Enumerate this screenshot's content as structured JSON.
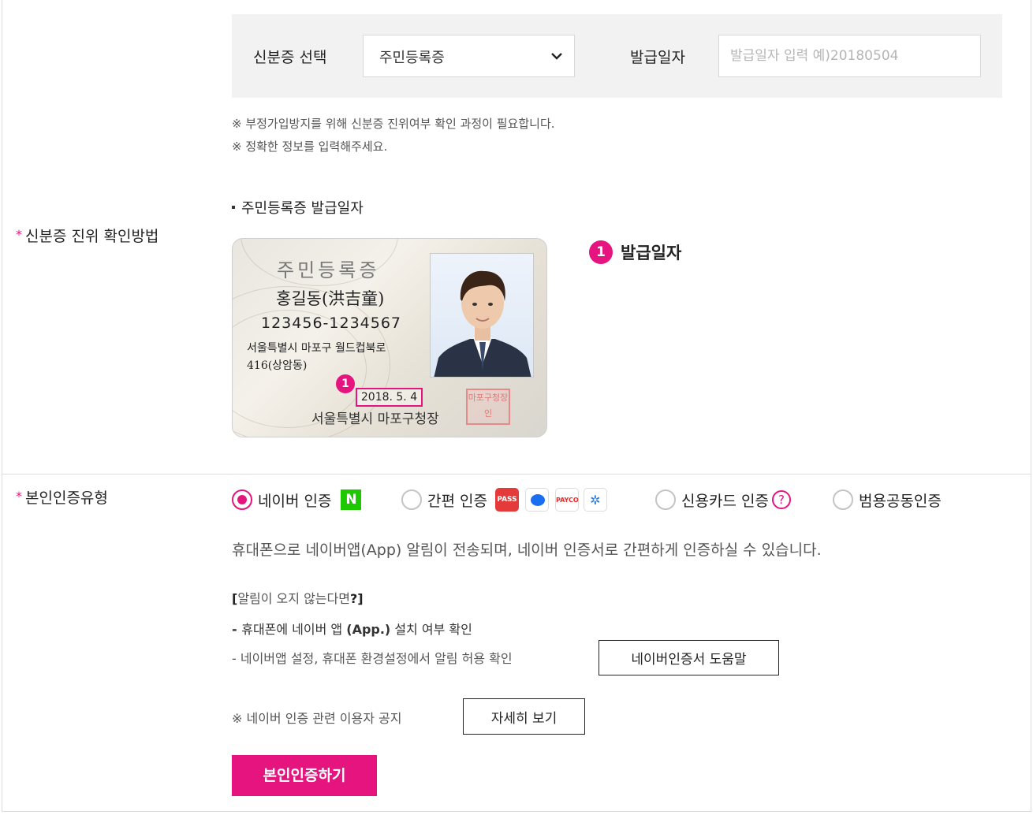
{
  "id_section": {
    "label": "신분증 진위 확인방법",
    "required_mark": "*",
    "id_type_label": "신분증 선택",
    "id_type_value": "주민등록증",
    "issue_date_label": "발급일자",
    "issue_date_placeholder": "발급일자 입력 예)20180504",
    "notices": [
      "※ 부정가입방지를 위해 신분증 진위여부 확인 과정이 필요합니다.",
      "※ 정확한 정보를 입력해주세요."
    ],
    "guide_title": "주민등록증 발급일자",
    "card": {
      "title": "주민등록증",
      "name": "홍길동(洪吉童)",
      "rrn": "123456-1234567",
      "address_line1": "서울특별시 마포구 월드컵북로",
      "address_line2": "416(상암동)",
      "issue_date": "2018. 5. 4",
      "issuer": "서울특별시 마포구청장",
      "stamp": "마포구청장인",
      "marker": "1"
    },
    "legend_number": "1",
    "legend_text": "발급일자"
  },
  "auth_section": {
    "label": "본인인증유형",
    "required_mark": "*",
    "options": [
      {
        "label": "네이버 인증",
        "selected": true
      },
      {
        "label": "간편 인증",
        "selected": false
      },
      {
        "label": "신용카드 인증",
        "selected": false
      },
      {
        "label": "범용공동인증",
        "selected": false
      }
    ],
    "logos": {
      "naver": "N",
      "pass": "PASS",
      "payco": "PAYCO",
      "kb": "✲"
    },
    "help_icon": "?",
    "description": "휴대폰으로 네이버앱(App) 알림이 전송되며, 네이버 인증서로 간편하게 인증하실 수 있습니다.",
    "tip_title_open": "[",
    "tip_title_text": "알림이 오지 않는다면",
    "tip_title_close": "?]",
    "tip1_dash": "- ",
    "tip1_a": "휴대폰에 네이버 앱 ",
    "tip1_b": "(App.)",
    "tip1_c": " 설치 여부 확인",
    "tip2": "- 네이버앱 설정, 휴대폰 환경설정에서 알림 허용 확인",
    "help_button": "네이버인증서 도움말",
    "notice": "※ 네이버 인증 관련 이용자 공지",
    "detail_button": "자세히 보기",
    "submit_button": "본인인증하기"
  },
  "colors": {
    "accent": "#e5147f",
    "panel_bg": "#f2f2f2",
    "border": "#dcdcdc"
  }
}
